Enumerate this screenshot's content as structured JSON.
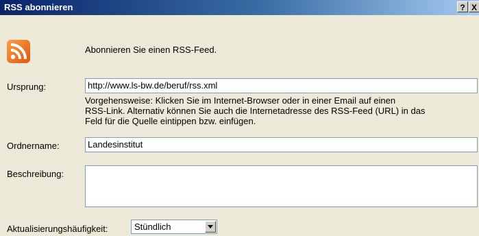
{
  "window": {
    "title": "RSS abonnieren",
    "help_label": "?",
    "close_label": "X"
  },
  "intro": {
    "icon": "rss-feed-icon",
    "icon_color": "#f27a1e",
    "text": "Abonnieren Sie einen RSS-Feed."
  },
  "origin": {
    "label": "Ursprung:",
    "value": "http://www.ls-bw.de/beruf/rss.xml"
  },
  "hint": {
    "line1": "Vorgehensweise: Klicken Sie im Internet-Browser oder in einer Email auf einen",
    "line2": "RSS-Link. Alternativ können Sie auch die Internetadresse des RSS-Feed (URL) in das",
    "line3": "Feld für die Quelle eintippen bzw. einfügen."
  },
  "folder": {
    "label": "Ordnername:",
    "value": "Landesinstitut"
  },
  "description": {
    "label": "Beschreibung:",
    "value": ""
  },
  "frequency": {
    "label": "Aktualisierungshäufigkeit:",
    "selected": "Stündlich"
  }
}
